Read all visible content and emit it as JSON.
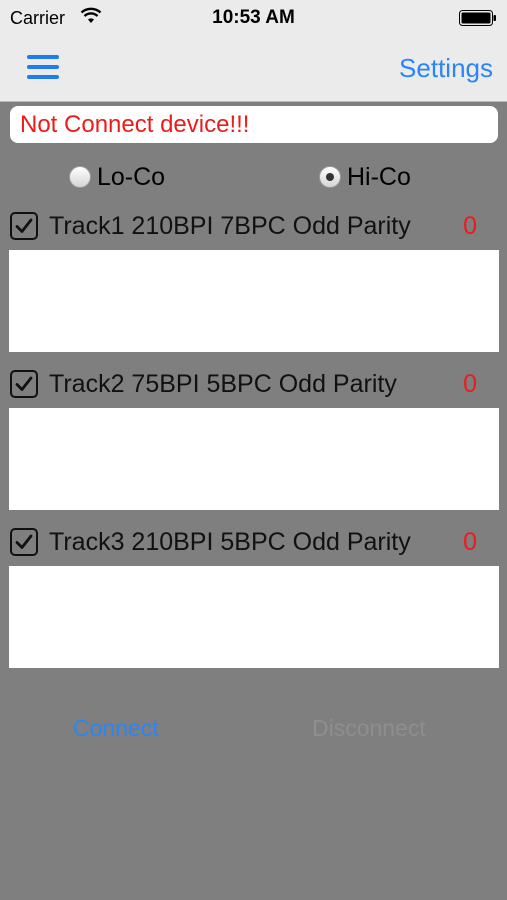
{
  "status_bar": {
    "carrier": "Carrier",
    "time": "10:53 AM"
  },
  "nav": {
    "menu_icon": "hamburger-menu-icon",
    "settings_label": "Settings"
  },
  "status_message": "Not Connect device!!!",
  "mode": {
    "options": [
      "Lo-Co",
      "Hi-Co"
    ],
    "selected": "Hi-Co"
  },
  "tracks": [
    {
      "label": "Track1 210BPI 7BPC Odd Parity",
      "count": "0",
      "checked": true,
      "data": ""
    },
    {
      "label": "Track2 75BPI 5BPC Odd Parity",
      "count": "0",
      "checked": true,
      "data": ""
    },
    {
      "label": "Track3 210BPI 5BPC Odd Parity",
      "count": "0",
      "checked": true,
      "data": ""
    }
  ],
  "actions": {
    "connect_label": "Connect",
    "disconnect_label": "Disconnect"
  },
  "colors": {
    "accent": "#2a85f5",
    "error": "#ee1b1b",
    "background": "#7f7f7f"
  }
}
